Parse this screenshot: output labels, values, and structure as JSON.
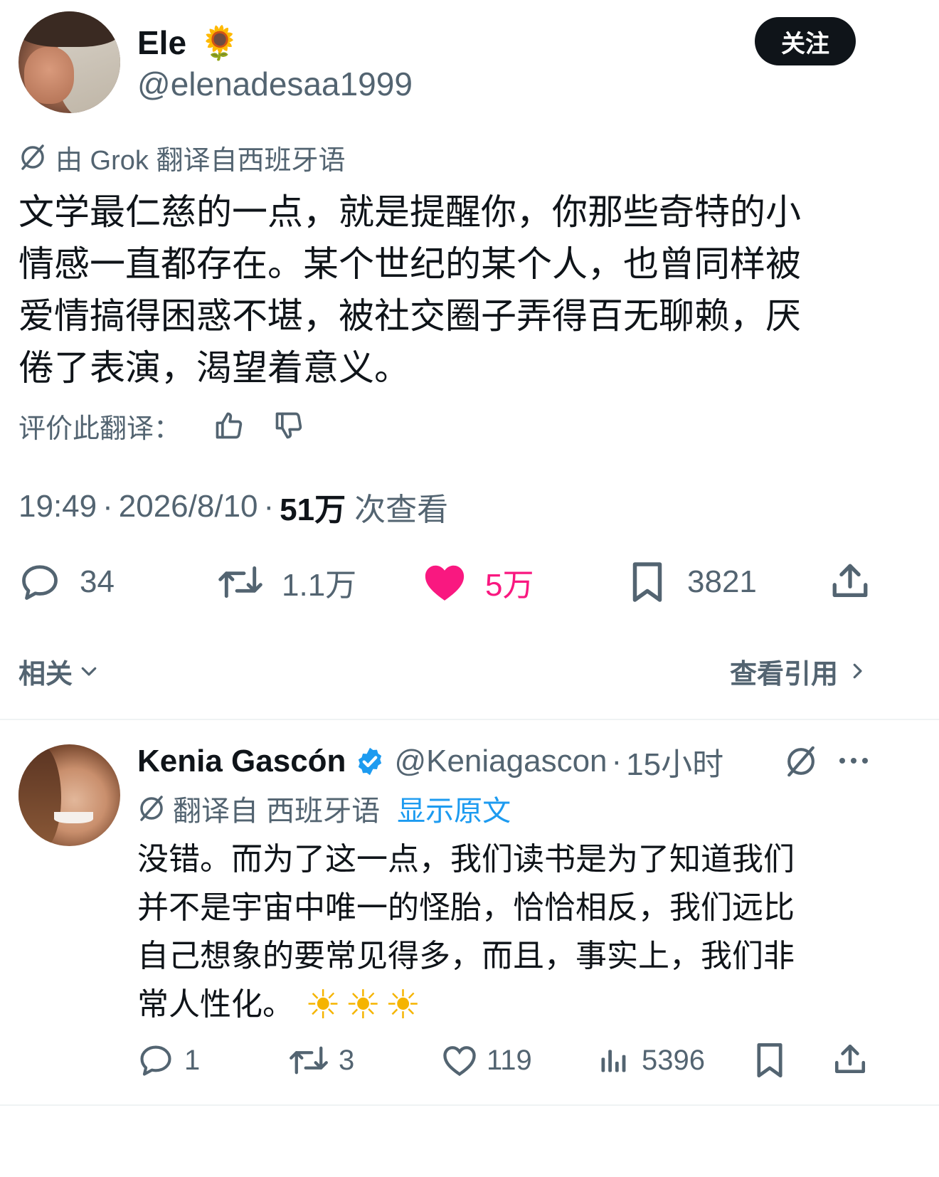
{
  "main_tweet": {
    "author_name": "Ele",
    "author_emoji": "🌻",
    "handle": "@elenadesaa1999",
    "follow_label": "关注",
    "translated_by": "由 Grok 翻译自西班牙语",
    "text_lines": [
      "文学最仁慈的一点，就是提醒你，你那些奇特的小",
      "情感一直都存在。某个世纪的某个人，也曾同样被",
      "爱情搞得困惑不堪，被社交圈子弄得百无聊赖，厌",
      "倦了表演，渴望着意义。"
    ],
    "rate_label": "评价此翻译：",
    "time": "19:49",
    "date": "2026/8/10",
    "views_count": "51万",
    "views_label": "次查看",
    "replies": "34",
    "retweets": "1.1万",
    "likes": "5万",
    "bookmarks": "3821"
  },
  "tabs": {
    "related_label": "相关",
    "quotes_label": "查看引用"
  },
  "reply": {
    "author_name": "Kenia Gascón",
    "handle": "@Keniagascon",
    "time": "15小时",
    "translated_from": "翻译自 西班牙语",
    "show_original": "显示原文",
    "text_lines": [
      "没错。而为了这一点，我们读书是为了知道我们",
      "并不是宇宙中唯一的怪胎，恰恰相反，我们远比",
      "自己想象的要常见得多，而且，事实上，我们非",
      "常人性化。"
    ],
    "suns": "☀☀☀",
    "replies": "1",
    "retweets": "3",
    "likes": "119",
    "views": "5396"
  },
  "colors": {
    "text": "#0f1419",
    "secondary": "#536471",
    "like_pink": "#f91880",
    "link_blue": "#1d9bf0"
  }
}
